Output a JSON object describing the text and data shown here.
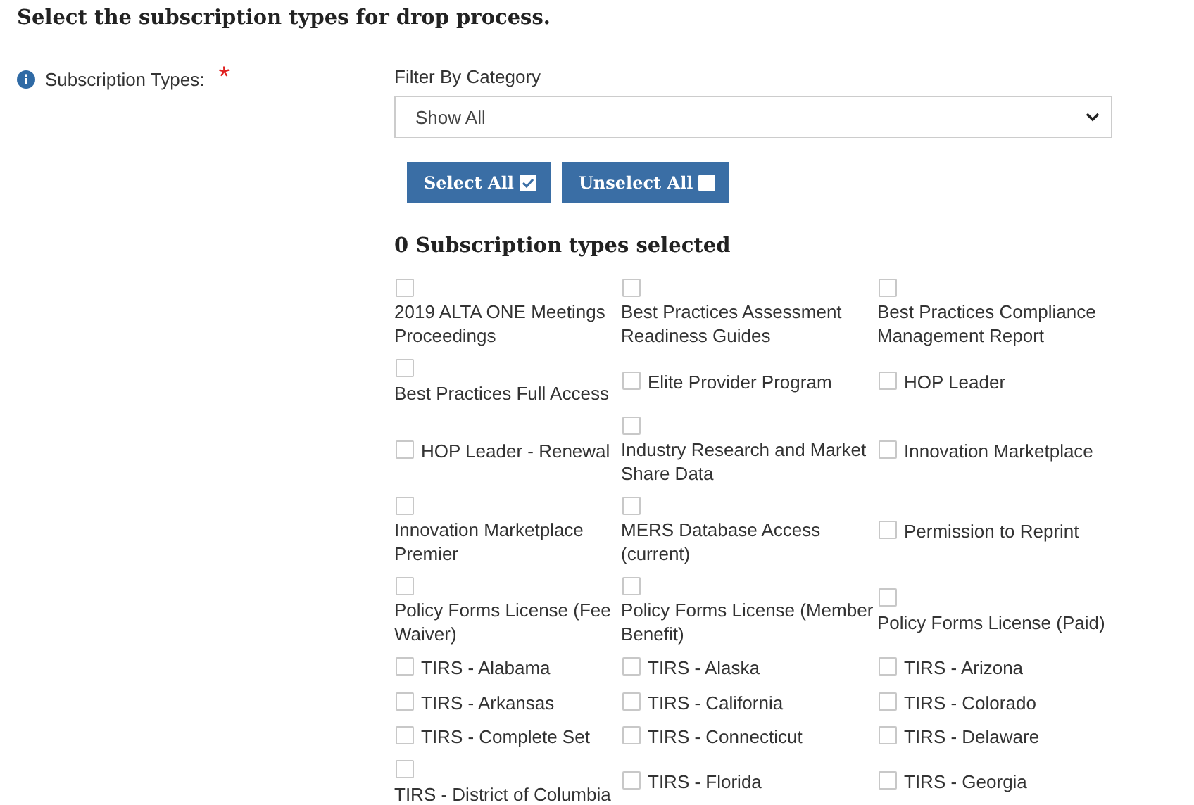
{
  "heading": "Select the subscription types for drop process.",
  "field": {
    "label": "Subscription Types:",
    "required_mark": "*"
  },
  "filter": {
    "label": "Filter By Category",
    "value": "Show All"
  },
  "buttons": [
    {
      "label": "Select All",
      "kind": "select"
    },
    {
      "label": "Unselect All",
      "kind": "unselect"
    }
  ],
  "count_heading": "0 Subscription types selected",
  "options": [
    {
      "label": "2019 ALTA ONE Meetings Proceedings",
      "checked": false
    },
    {
      "label": "Best Practices Assessment Readiness Guides",
      "checked": false
    },
    {
      "label": "Best Practices Compliance Management Report",
      "checked": false
    },
    {
      "label": "Best Practices Full Access",
      "checked": false
    },
    {
      "label": "Elite Provider Program",
      "checked": false
    },
    {
      "label": "HOP Leader",
      "checked": false
    },
    {
      "label": "HOP Leader - Renewal",
      "checked": false
    },
    {
      "label": "Industry Research and Market Share Data",
      "checked": false
    },
    {
      "label": "Innovation Marketplace",
      "checked": false
    },
    {
      "label": "Innovation Marketplace Premier",
      "checked": false
    },
    {
      "label": "MERS Database Access (current)",
      "checked": false
    },
    {
      "label": "Permission to Reprint",
      "checked": false
    },
    {
      "label": "Policy Forms License (Fee Waiver)",
      "checked": false
    },
    {
      "label": "Policy Forms License (Member Benefit)",
      "checked": false
    },
    {
      "label": "Policy Forms License (Paid)",
      "checked": false
    },
    {
      "label": "TIRS - Alabama",
      "checked": false
    },
    {
      "label": "TIRS - Alaska",
      "checked": false
    },
    {
      "label": "TIRS - Arizona",
      "checked": false
    },
    {
      "label": "TIRS - Arkansas",
      "checked": false
    },
    {
      "label": "TIRS - California",
      "checked": false
    },
    {
      "label": "TIRS - Colorado",
      "checked": false
    },
    {
      "label": "TIRS - Complete Set",
      "checked": false
    },
    {
      "label": "TIRS - Connecticut",
      "checked": false
    },
    {
      "label": "TIRS - Delaware",
      "checked": false
    },
    {
      "label": "TIRS - District of Columbia",
      "checked": false
    },
    {
      "label": "TIRS - Florida",
      "checked": false
    },
    {
      "label": "TIRS - Georgia",
      "checked": false
    }
  ]
}
